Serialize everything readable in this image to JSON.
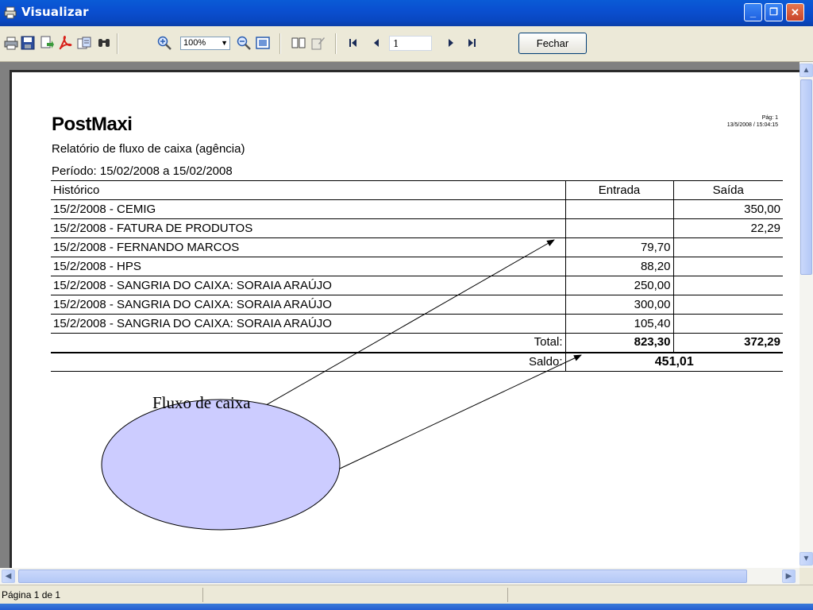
{
  "window": {
    "title": "Visualizar",
    "close_glyph": "✕",
    "minimize_glyph": "_",
    "restore_glyph": "❐"
  },
  "toolbar": {
    "icons": [
      "printer-icon",
      "save-icon",
      "export-icon",
      "pdf-icon",
      "email-icon",
      "find-icon",
      "zoom-in-icon",
      "zoom-out-icon",
      "page-width-icon",
      "two-pages-icon",
      "edit-icon",
      "first-page-icon",
      "prev-page-icon",
      "next-page-icon",
      "last-page-icon"
    ],
    "zoom_value": "100%",
    "page_value": "1",
    "close_label": "Fechar"
  },
  "report": {
    "company": "PostMaxi",
    "title": "Relatório de fluxo de caixa (agência)",
    "period": "Período: 15/02/2008 a 15/02/2008",
    "page_number": "Pág: 1",
    "datetime": "13/5/2008 / 15:04:15",
    "columns": {
      "historico": "Histórico",
      "entrada": "Entrada",
      "saida": "Saída"
    },
    "rows": [
      {
        "historico": "15/2/2008 - CEMIG",
        "entrada": "",
        "saida": "350,00"
      },
      {
        "historico": "15/2/2008 - FATURA DE PRODUTOS",
        "entrada": "",
        "saida": "22,29"
      },
      {
        "historico": "15/2/2008 - FERNANDO MARCOS",
        "entrada": "79,70",
        "saida": ""
      },
      {
        "historico": "15/2/2008 - HPS",
        "entrada": "88,20",
        "saida": ""
      },
      {
        "historico": "15/2/2008 - SANGRIA DO CAIXA: SORAIA ARAÚJO",
        "entrada": "250,00",
        "saida": ""
      },
      {
        "historico": "15/2/2008 - SANGRIA DO CAIXA: SORAIA ARAÚJO",
        "entrada": "300,00",
        "saida": ""
      },
      {
        "historico": "15/2/2008 - SANGRIA DO CAIXA: SORAIA ARAÚJO",
        "entrada": "105,40",
        "saida": ""
      }
    ],
    "total_label": "Total:",
    "total_entrada": "823,30",
    "total_saida": "372,29",
    "saldo_label": "Saldo:",
    "saldo_value": "451,01"
  },
  "annotation": {
    "label": "Fluxo de caixa",
    "fill": "#ccccff"
  },
  "statusbar": {
    "page_info": "Página 1 de 1"
  },
  "colors": {
    "titlebar": "#0a4fd0",
    "page_background": "#808080",
    "scrollbar": "#b9cdf8"
  }
}
